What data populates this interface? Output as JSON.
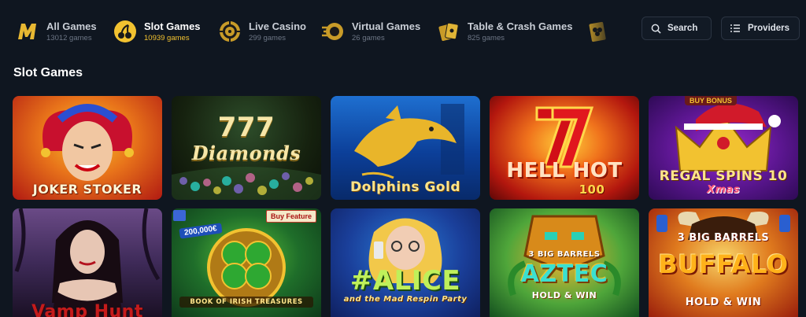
{
  "categories": [
    {
      "name": "All Games",
      "count": "13012 games",
      "icon": "casino-m-logo-icon"
    },
    {
      "name": "Slot Games",
      "count": "10939 games",
      "icon": "cherries-icon"
    },
    {
      "name": "Live Casino",
      "count": "299 games",
      "icon": "roulette-icon"
    },
    {
      "name": "Virtual Games",
      "count": "26 games",
      "icon": "virtual-racing-icon"
    },
    {
      "name": "Table & Crash Games",
      "count": "825 games",
      "icon": "cards-icon"
    },
    {
      "name": "",
      "count": "",
      "icon": "clover-card-icon"
    }
  ],
  "search_label": "Search",
  "providers_label": "Providers",
  "section_title": "Slot Games",
  "games": [
    {
      "title": "JOKER STOKER"
    },
    {
      "title": "777",
      "subtitle": "Diamonds"
    },
    {
      "title": "Dolphins Gold"
    },
    {
      "title": "HELL HOT",
      "subtitle": "100"
    },
    {
      "title": "REGAL SPINS 10",
      "subtitle": "Xmas",
      "badge": "BUY BONUS"
    },
    {
      "title": "Vamp Hunt"
    },
    {
      "title": "BOOK OF IRISH TREASURES",
      "badge": "Buy Feature",
      "amount": "200,000€"
    },
    {
      "title": "#ALICE",
      "subtitle": "and the Mad Respin Party"
    },
    {
      "title": "AZTEC",
      "subtitle": "HOLD & WIN",
      "badge": "3 BIG BARRELS"
    },
    {
      "title": "BUFFALO",
      "subtitle": "HOLD & WIN",
      "badge": "3 BIG BARRELS"
    }
  ],
  "colors": {
    "background": "#0f1620",
    "active_count": "#f2c230",
    "border": "#2b3442"
  }
}
